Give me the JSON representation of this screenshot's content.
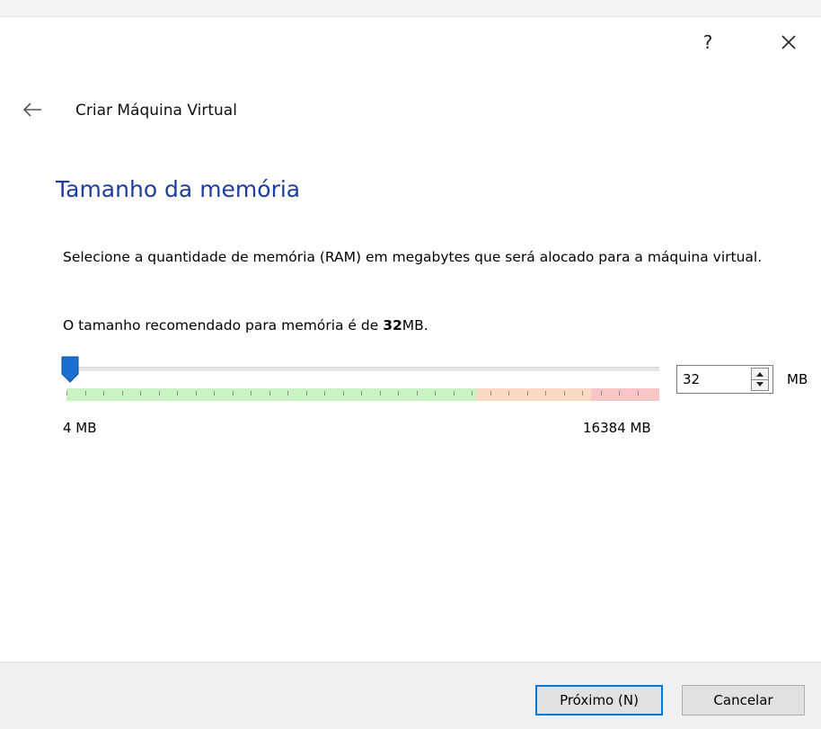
{
  "window": {
    "help_label": "?"
  },
  "wizard": {
    "title": "Criar Máquina Virtual"
  },
  "page": {
    "heading": "Tamanho da memória",
    "description": "Selecione a quantidade de memória (RAM) em megabytes que será alocado para a máquina virtual.",
    "recommend_prefix": "O tamanho recomendado para memória é de ",
    "recommend_value": "32",
    "recommend_suffix": "MB."
  },
  "memory": {
    "value": "32",
    "unit": "MB",
    "min_label": "4 MB",
    "max_label": "16384 MB",
    "min_mb": 4,
    "max_mb": 16384,
    "current_mb": 32
  },
  "buttons": {
    "next_label": "Próximo (N)",
    "cancel_label": "Cancelar"
  },
  "colors": {
    "heading": "#1f3d9c",
    "slider_handle": "#1a6fd0",
    "band_green": "#c9f3c2",
    "band_orange": "#fbd8c2",
    "band_red": "#f8c6c6",
    "focus_border": "#0078d7"
  },
  "icons": {
    "back": "arrow-left-icon",
    "close": "close-icon",
    "spin_up": "triangle-up-icon",
    "spin_down": "triangle-down-icon"
  }
}
